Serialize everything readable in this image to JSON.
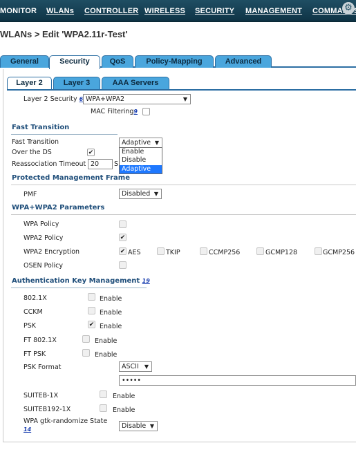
{
  "nav": {
    "monitor": "MONITOR",
    "wlans": "WLANs",
    "controller": "CONTROLLER",
    "wireless": "WIRELESS",
    "security": "SECURITY",
    "management": "MANAGEMENT",
    "commands": "COMMANDS"
  },
  "page_title": "WLANs > Edit  'WPA2.11r-Test'",
  "outer_tabs": [
    "General",
    "Security",
    "QoS",
    "Policy-Mapping",
    "Advanced"
  ],
  "inner_tabs": [
    "Layer 2",
    "Layer 3",
    "AAA Servers"
  ],
  "layer2": {
    "security_label": "Layer 2 Security",
    "security_note": "6",
    "security_value": "WPA+WPA2",
    "mac_filtering_label": "MAC Filtering",
    "mac_filtering_note": "9"
  },
  "fast_transition": {
    "heading": "Fast Transition",
    "ft_label": "Fast Transition",
    "ft_value": "Adaptive",
    "ft_options": [
      "Enable",
      "Disable",
      "Adaptive"
    ],
    "over_ds_label": "Over the DS",
    "reassoc_label": "Reassociation Timeout",
    "reassoc_value": "20",
    "reassoc_unit": "S"
  },
  "pmf": {
    "heading": "Protected Management Frame",
    "label": "PMF",
    "value": "Disabled"
  },
  "wpa_params": {
    "heading": "WPA+WPA2 Parameters",
    "wpa_policy": "WPA Policy",
    "wpa2_policy": "WPA2 Policy",
    "wpa2_encryption": "WPA2 Encryption",
    "enc_aes": "AES",
    "enc_tkip": "TKIP",
    "enc_ccmp256": "CCMP256",
    "enc_gcmp128": "GCMP128",
    "enc_gcmp256": "GCMP256",
    "osen_policy": "OSEN Policy"
  },
  "akm": {
    "heading": "Authentication Key Management",
    "note": "19",
    "enable": "Enable",
    "rows": [
      "802.1X",
      "CCKM",
      "PSK",
      "FT 802.1X",
      "FT PSK"
    ],
    "psk_format_label": "PSK Format",
    "psk_format_value": "ASCII",
    "psk_value": "•••••",
    "suiteb_1x": "SUITEB-1X",
    "suiteb192_1x": "SUITEB192-1X",
    "gtk_label": "WPA gtk-randomize State",
    "gtk_note": "14",
    "gtk_value": "Disable"
  },
  "icons": {
    "nav_gear": "gear-icon",
    "dropdown_arrow": "triangle-down-icon",
    "check": "checkmark-icon"
  }
}
